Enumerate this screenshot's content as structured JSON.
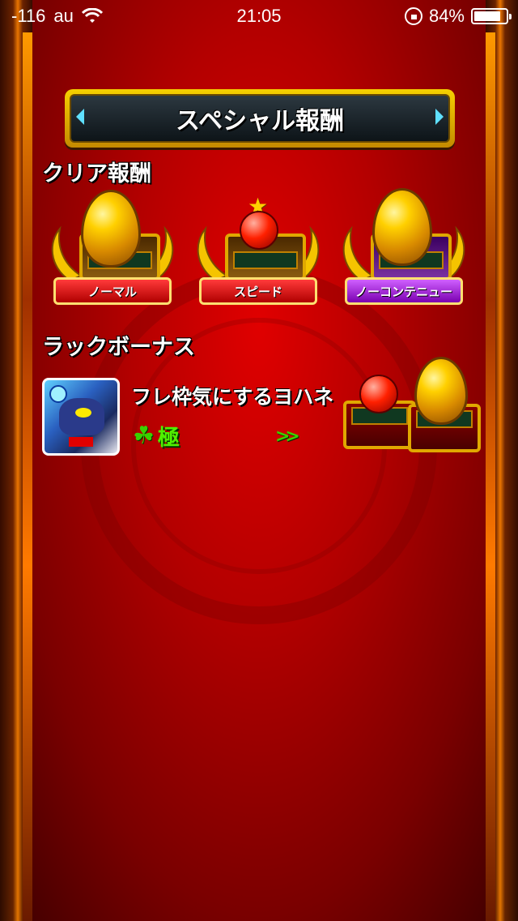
{
  "status_bar": {
    "signal": "-116",
    "carrier": "au",
    "time": "21:05",
    "battery": "84%",
    "battery_level": 0.84
  },
  "title": "スペシャル報酬",
  "clear_rewards": {
    "heading": "クリア報酬",
    "items": [
      {
        "label": "ノーマル",
        "reward": "gold-egg",
        "ribbon_color": "#c00000"
      },
      {
        "label": "スピード",
        "reward": "red-gem",
        "ribbon_color": "#c00000"
      },
      {
        "label": "ノーコンテニュー",
        "reward": "gold-egg",
        "ribbon_color": "#9a00d0"
      }
    ]
  },
  "luck_bonus": {
    "heading": "ラックボーナス",
    "monster_name": "フレ枠気にするヨハネ",
    "luck_label": "極",
    "rewards": [
      "red-gem",
      "gold-egg"
    ]
  },
  "colors": {
    "background": "#c00000",
    "frame": "#ff8a00",
    "luck_green": "#50f000"
  }
}
